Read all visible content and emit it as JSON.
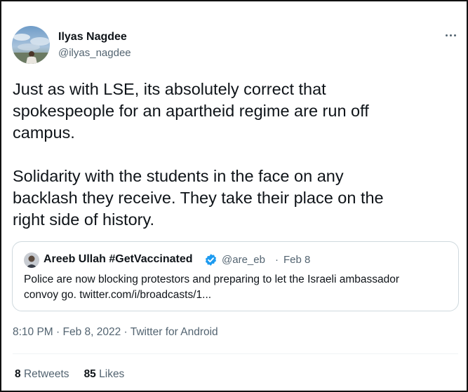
{
  "author": {
    "name": "Ilyas Nagdee",
    "handle": "@ilyas_nagdee"
  },
  "more_icon": "more-horizontal-icon",
  "tweet_text": "Just as with LSE, its absolutely correct that\nspokespeople for an apartheid regime are run off\ncampus.\n\nSolidarity with the students in the face on any\nbacklash they receive. They take their place on the\nright side of history.",
  "quoted": {
    "name": "Areeb Ullah #GetVaccinated",
    "verified_icon": "verified-badge-icon",
    "handle": "@are_eb",
    "separator": "·",
    "date": "Feb 8",
    "text": "Police are now blocking protestors and preparing to let the Israeli ambassador\nconvoy go. twitter.com/i/broadcasts/1..."
  },
  "meta": {
    "time": "8:10 PM",
    "sep1": " · ",
    "date": "Feb 8, 2022",
    "sep2": " · ",
    "source": "Twitter for Android"
  },
  "stats": {
    "retweets_count": "8",
    "retweets_label": "Retweets",
    "likes_count": "85",
    "likes_label": "Likes"
  },
  "colors": {
    "text": "#0f1419",
    "secondary": "#536471",
    "verified": "#1d9bf0",
    "border": "#cfd9de"
  }
}
